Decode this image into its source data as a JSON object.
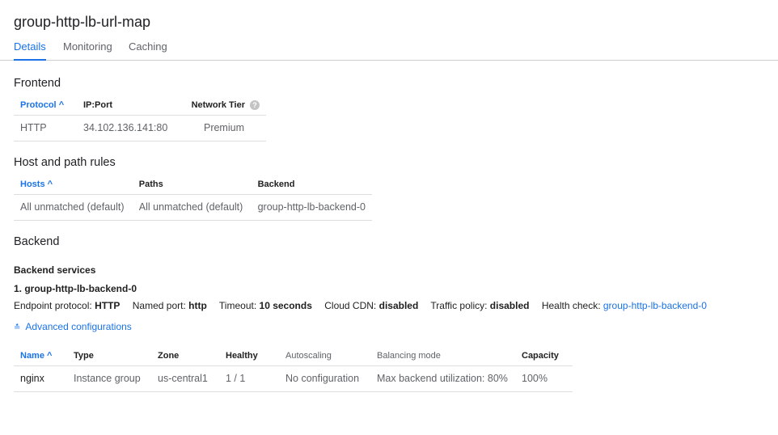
{
  "title": "group-http-lb-url-map",
  "tabs": [
    "Details",
    "Monitoring",
    "Caching"
  ],
  "frontend": {
    "heading": "Frontend",
    "columns": [
      "Protocol",
      "IP:Port",
      "Network Tier"
    ],
    "row": [
      "HTTP",
      "34.102.136.141:80",
      "Premium"
    ]
  },
  "hostpath": {
    "heading": "Host and path rules",
    "columns": [
      "Hosts",
      "Paths",
      "Backend"
    ],
    "row": [
      "All unmatched (default)",
      "All unmatched (default)",
      "group-http-lb-backend-0"
    ]
  },
  "backend": {
    "heading": "Backend",
    "services_label": "Backend services",
    "service_name": "1. group-http-lb-backend-0",
    "props": [
      {
        "k": "Endpoint protocol:",
        "v": "HTTP"
      },
      {
        "k": "Named port:",
        "v": "http"
      },
      {
        "k": "Timeout:",
        "v": "10 seconds"
      },
      {
        "k": "Cloud CDN:",
        "v": "disabled"
      },
      {
        "k": "Traffic policy:",
        "v": "disabled"
      }
    ],
    "health_label": "Health check:",
    "health_link": "group-http-lb-backend-0",
    "advanced": "Advanced configurations",
    "columns": [
      "Name",
      "Type",
      "Zone",
      "Healthy",
      "Autoscaling",
      "Balancing mode",
      "Capacity"
    ],
    "row": [
      "nginx",
      "Instance group",
      "us-central1",
      "1 / 1",
      "No configuration",
      "Max backend utilization: 80%",
      "100%"
    ]
  },
  "colors": {
    "accent": "#1a73e8"
  }
}
